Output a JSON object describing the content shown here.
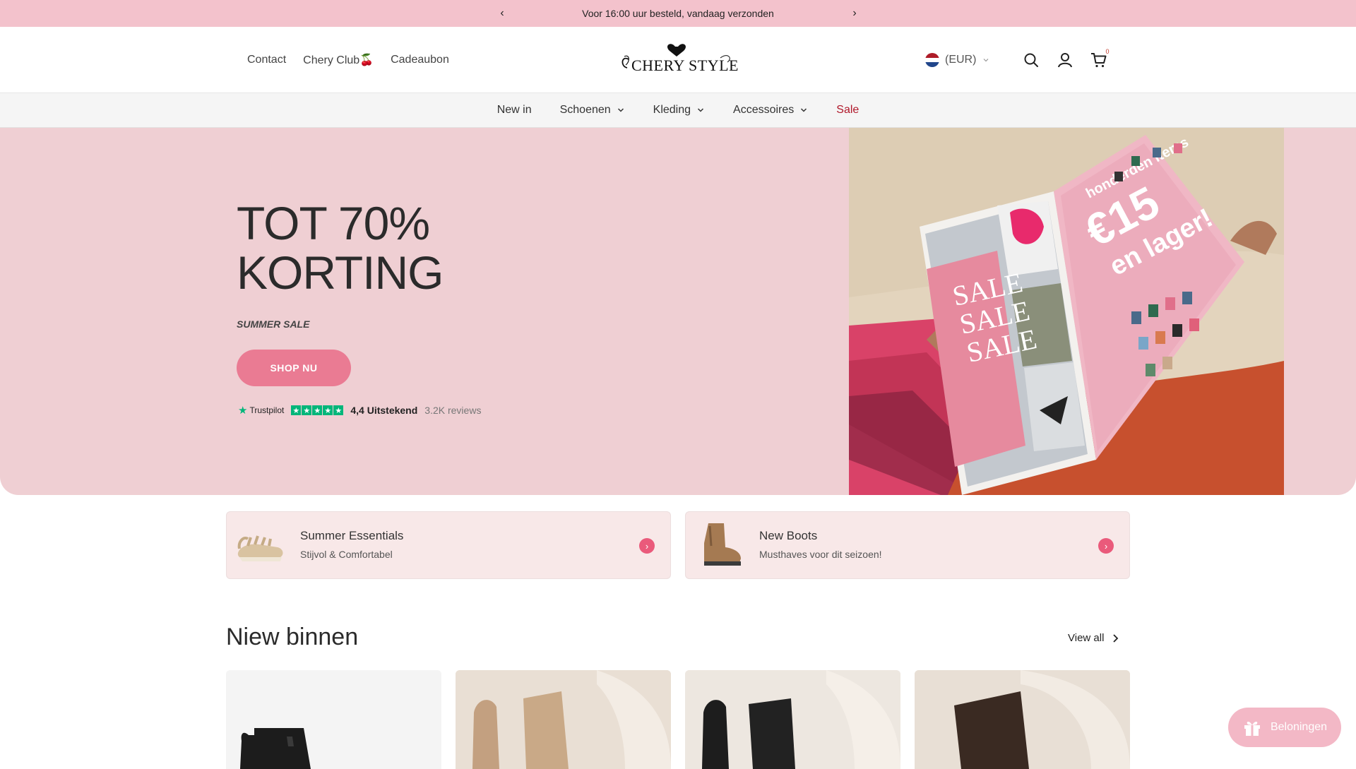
{
  "announcement": {
    "text": "Voor 16:00 uur besteld, vandaag verzonden",
    "prev": "‹",
    "next": "›"
  },
  "header": {
    "links": [
      "Contact",
      "Chery Club🍒",
      "Cadeaubon"
    ],
    "logo_text": "CHERY STYLE",
    "currency": "(EUR)",
    "cart_count": "0"
  },
  "nav": {
    "items": [
      {
        "label": "New in"
      },
      {
        "label": "Schoenen"
      },
      {
        "label": "Kleding"
      },
      {
        "label": "Accessoires"
      },
      {
        "label": "Sale"
      }
    ]
  },
  "hero": {
    "headline_line1": "TOT 70%",
    "headline_line2": "KORTING",
    "subtitle": "SUMMER SALE",
    "cta": "SHOP NU",
    "trustpilot": {
      "brand": "Trustpilot",
      "score": "4,4 Uitstekend",
      "reviews": "3.2K reviews",
      "rating_stars": 5
    },
    "image_text": {
      "sale": "SALE",
      "price": "€15",
      "line1": "honderden items",
      "line2": "en lager!"
    }
  },
  "promos": [
    {
      "title": "Summer Essentials",
      "desc": "Stijvol & Comfortabel"
    },
    {
      "title": "New Boots",
      "desc": "Musthaves voor dit seizoen!"
    }
  ],
  "new_section": {
    "title": "Niew binnen",
    "view_all": "View all"
  },
  "rewards": {
    "label": "Beloningen"
  },
  "colors": {
    "announcement": "#f3c2cc",
    "hero_bg": "#efcfd3",
    "cta": "#ea7b93",
    "sale": "#b0182a",
    "trustpilot": "#00b67a"
  }
}
